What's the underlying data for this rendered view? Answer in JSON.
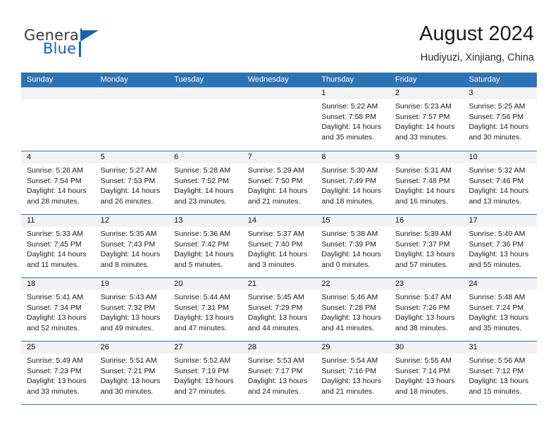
{
  "brand": {
    "name_part1": "General",
    "name_part2": "Blue",
    "accent_color": "#1464b4"
  },
  "header": {
    "title": "August 2024",
    "subtitle": "Hudiyuzi, Xinjiang, China"
  },
  "calendar": {
    "header_color": "#2e74b5",
    "weekdays": [
      "Sunday",
      "Monday",
      "Tuesday",
      "Wednesday",
      "Thursday",
      "Friday",
      "Saturday"
    ],
    "weeks": [
      [
        {
          "day": "",
          "sunrise": "",
          "sunset": "",
          "daylight": "",
          "daylight2": "",
          "empty": true
        },
        {
          "day": "",
          "sunrise": "",
          "sunset": "",
          "daylight": "",
          "daylight2": "",
          "empty": true
        },
        {
          "day": "",
          "sunrise": "",
          "sunset": "",
          "daylight": "",
          "daylight2": "",
          "empty": true
        },
        {
          "day": "",
          "sunrise": "",
          "sunset": "",
          "daylight": "",
          "daylight2": "",
          "empty": true
        },
        {
          "day": "1",
          "sunrise": "Sunrise: 5:22 AM",
          "sunset": "Sunset: 7:58 PM",
          "daylight": "Daylight: 14 hours",
          "daylight2": "and 35 minutes."
        },
        {
          "day": "2",
          "sunrise": "Sunrise: 5:23 AM",
          "sunset": "Sunset: 7:57 PM",
          "daylight": "Daylight: 14 hours",
          "daylight2": "and 33 minutes."
        },
        {
          "day": "3",
          "sunrise": "Sunrise: 5:25 AM",
          "sunset": "Sunset: 7:56 PM",
          "daylight": "Daylight: 14 hours",
          "daylight2": "and 30 minutes."
        }
      ],
      [
        {
          "day": "4",
          "sunrise": "Sunrise: 5:26 AM",
          "sunset": "Sunset: 7:54 PM",
          "daylight": "Daylight: 14 hours",
          "daylight2": "and 28 minutes."
        },
        {
          "day": "5",
          "sunrise": "Sunrise: 5:27 AM",
          "sunset": "Sunset: 7:53 PM",
          "daylight": "Daylight: 14 hours",
          "daylight2": "and 26 minutes."
        },
        {
          "day": "6",
          "sunrise": "Sunrise: 5:28 AM",
          "sunset": "Sunset: 7:52 PM",
          "daylight": "Daylight: 14 hours",
          "daylight2": "and 23 minutes."
        },
        {
          "day": "7",
          "sunrise": "Sunrise: 5:29 AM",
          "sunset": "Sunset: 7:50 PM",
          "daylight": "Daylight: 14 hours",
          "daylight2": "and 21 minutes."
        },
        {
          "day": "8",
          "sunrise": "Sunrise: 5:30 AM",
          "sunset": "Sunset: 7:49 PM",
          "daylight": "Daylight: 14 hours",
          "daylight2": "and 18 minutes."
        },
        {
          "day": "9",
          "sunrise": "Sunrise: 5:31 AM",
          "sunset": "Sunset: 7:48 PM",
          "daylight": "Daylight: 14 hours",
          "daylight2": "and 16 minutes."
        },
        {
          "day": "10",
          "sunrise": "Sunrise: 5:32 AM",
          "sunset": "Sunset: 7:46 PM",
          "daylight": "Daylight: 14 hours",
          "daylight2": "and 13 minutes."
        }
      ],
      [
        {
          "day": "11",
          "sunrise": "Sunrise: 5:33 AM",
          "sunset": "Sunset: 7:45 PM",
          "daylight": "Daylight: 14 hours",
          "daylight2": "and 11 minutes."
        },
        {
          "day": "12",
          "sunrise": "Sunrise: 5:35 AM",
          "sunset": "Sunset: 7:43 PM",
          "daylight": "Daylight: 14 hours",
          "daylight2": "and 8 minutes."
        },
        {
          "day": "13",
          "sunrise": "Sunrise: 5:36 AM",
          "sunset": "Sunset: 7:42 PM",
          "daylight": "Daylight: 14 hours",
          "daylight2": "and 5 minutes."
        },
        {
          "day": "14",
          "sunrise": "Sunrise: 5:37 AM",
          "sunset": "Sunset: 7:40 PM",
          "daylight": "Daylight: 14 hours",
          "daylight2": "and 3 minutes."
        },
        {
          "day": "15",
          "sunrise": "Sunrise: 5:38 AM",
          "sunset": "Sunset: 7:39 PM",
          "daylight": "Daylight: 14 hours",
          "daylight2": "and 0 minutes."
        },
        {
          "day": "16",
          "sunrise": "Sunrise: 5:39 AM",
          "sunset": "Sunset: 7:37 PM",
          "daylight": "Daylight: 13 hours",
          "daylight2": "and 57 minutes."
        },
        {
          "day": "17",
          "sunrise": "Sunrise: 5:40 AM",
          "sunset": "Sunset: 7:36 PM",
          "daylight": "Daylight: 13 hours",
          "daylight2": "and 55 minutes."
        }
      ],
      [
        {
          "day": "18",
          "sunrise": "Sunrise: 5:41 AM",
          "sunset": "Sunset: 7:34 PM",
          "daylight": "Daylight: 13 hours",
          "daylight2": "and 52 minutes."
        },
        {
          "day": "19",
          "sunrise": "Sunrise: 5:43 AM",
          "sunset": "Sunset: 7:32 PM",
          "daylight": "Daylight: 13 hours",
          "daylight2": "and 49 minutes."
        },
        {
          "day": "20",
          "sunrise": "Sunrise: 5:44 AM",
          "sunset": "Sunset: 7:31 PM",
          "daylight": "Daylight: 13 hours",
          "daylight2": "and 47 minutes."
        },
        {
          "day": "21",
          "sunrise": "Sunrise: 5:45 AM",
          "sunset": "Sunset: 7:29 PM",
          "daylight": "Daylight: 13 hours",
          "daylight2": "and 44 minutes."
        },
        {
          "day": "22",
          "sunrise": "Sunrise: 5:46 AM",
          "sunset": "Sunset: 7:28 PM",
          "daylight": "Daylight: 13 hours",
          "daylight2": "and 41 minutes."
        },
        {
          "day": "23",
          "sunrise": "Sunrise: 5:47 AM",
          "sunset": "Sunset: 7:26 PM",
          "daylight": "Daylight: 13 hours",
          "daylight2": "and 38 minutes."
        },
        {
          "day": "24",
          "sunrise": "Sunrise: 5:48 AM",
          "sunset": "Sunset: 7:24 PM",
          "daylight": "Daylight: 13 hours",
          "daylight2": "and 35 minutes."
        }
      ],
      [
        {
          "day": "25",
          "sunrise": "Sunrise: 5:49 AM",
          "sunset": "Sunset: 7:23 PM",
          "daylight": "Daylight: 13 hours",
          "daylight2": "and 33 minutes."
        },
        {
          "day": "26",
          "sunrise": "Sunrise: 5:51 AM",
          "sunset": "Sunset: 7:21 PM",
          "daylight": "Daylight: 13 hours",
          "daylight2": "and 30 minutes."
        },
        {
          "day": "27",
          "sunrise": "Sunrise: 5:52 AM",
          "sunset": "Sunset: 7:19 PM",
          "daylight": "Daylight: 13 hours",
          "daylight2": "and 27 minutes."
        },
        {
          "day": "28",
          "sunrise": "Sunrise: 5:53 AM",
          "sunset": "Sunset: 7:17 PM",
          "daylight": "Daylight: 13 hours",
          "daylight2": "and 24 minutes."
        },
        {
          "day": "29",
          "sunrise": "Sunrise: 5:54 AM",
          "sunset": "Sunset: 7:16 PM",
          "daylight": "Daylight: 13 hours",
          "daylight2": "and 21 minutes."
        },
        {
          "day": "30",
          "sunrise": "Sunrise: 5:55 AM",
          "sunset": "Sunset: 7:14 PM",
          "daylight": "Daylight: 13 hours",
          "daylight2": "and 18 minutes."
        },
        {
          "day": "31",
          "sunrise": "Sunrise: 5:56 AM",
          "sunset": "Sunset: 7:12 PM",
          "daylight": "Daylight: 13 hours",
          "daylight2": "and 15 minutes."
        }
      ]
    ]
  }
}
